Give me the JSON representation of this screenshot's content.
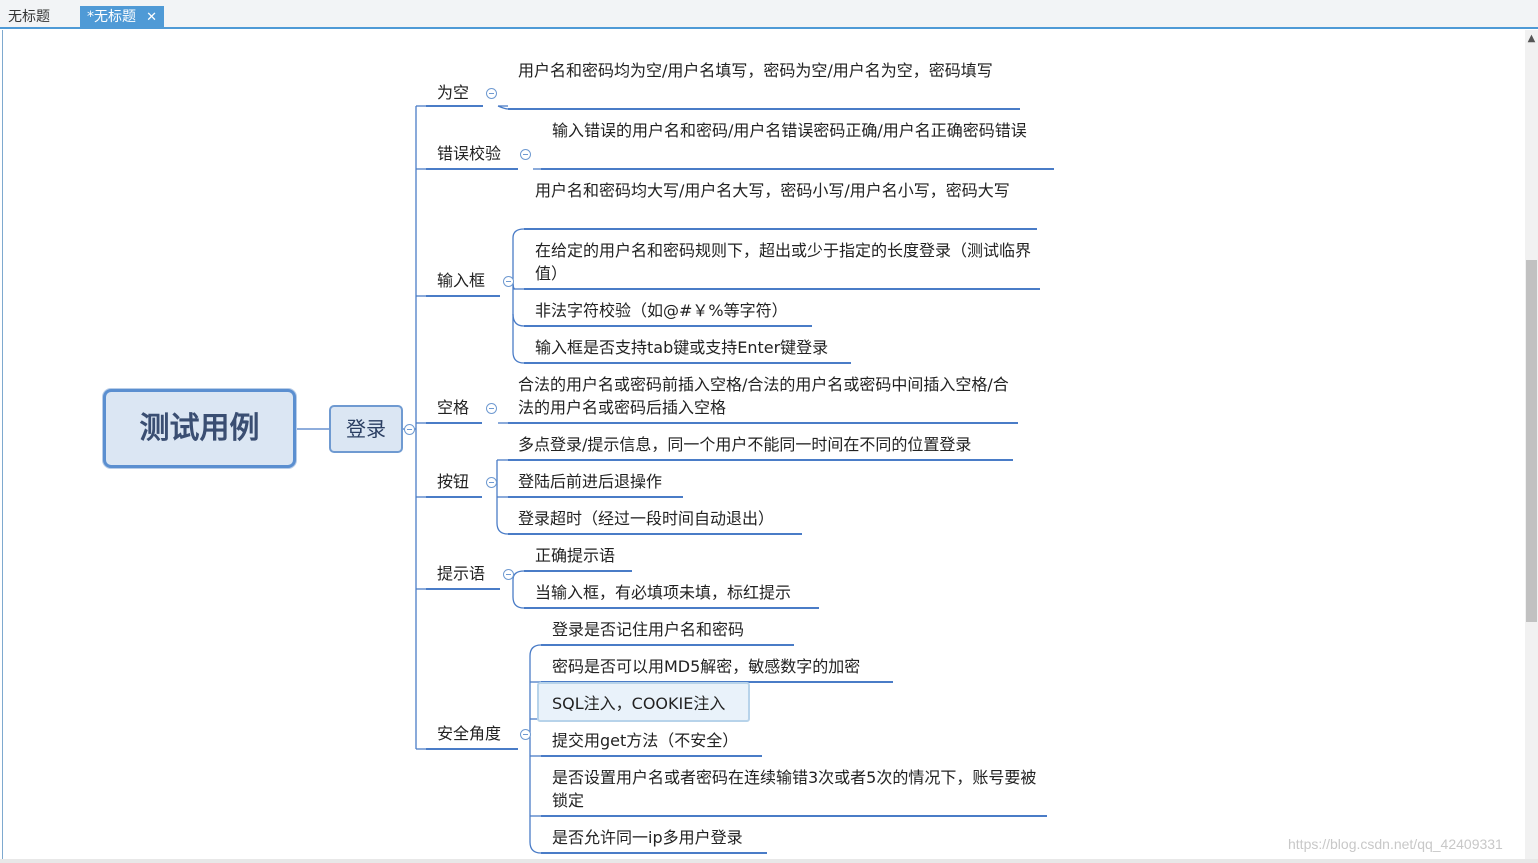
{
  "tabs": [
    {
      "label": "无标题"
    },
    {
      "label": "*无标题",
      "close": "✕"
    }
  ],
  "map": {
    "root": "测试用例",
    "branch": "登录",
    "categories": [
      {
        "label": "为空",
        "items": [
          "用户名和密码均为空/用户名填写，密码为空/用户名为空，密码填写"
        ]
      },
      {
        "label": "错误校验",
        "items": [
          "输入错误的用户名和密码/用户名错误密码正确/用户名正确密码错误"
        ]
      },
      {
        "label": "输入框",
        "items": [
          "用户名和密码均大写/用户名大写，密码小写/用户名小写，密码大写",
          "在给定的用户名和密码规则下，超出或少于指定的长度登录（测试临界值）",
          "非法字符校验（如@#￥%等字符）",
          "输入框是否支持tab键或支持Enter键登录"
        ]
      },
      {
        "label": "空格",
        "items": [
          " 合法的用户名或密码前插入空格/合法的用户名或密码中间插入空格/合法的用户名或密码后插入空格"
        ]
      },
      {
        "label": "按钮",
        "items": [
          "多点登录/提示信息，同一个用户不能同一时间在不同的位置登录",
          "登陆后前进后退操作",
          "登录超时（经过一段时间自动退出）"
        ]
      },
      {
        "label": "提示语",
        "items": [
          "正确提示语",
          "当输入框，有必填项未填，标红提示"
        ]
      },
      {
        "label": "安全角度",
        "items": [
          "登录是否记住用户名和密码",
          "密码是否可以用MD5解密，敏感数字的加密",
          "SQL注入，COOKIE注入",
          "提交用get方法（不安全）",
          " 是否设置用户名或者密码在连续输错3次或者5次的情况下，账号要被锁定",
          "是否允许同一ip多用户登录"
        ]
      }
    ]
  },
  "scrollbar": {
    "up_arrow": "▲"
  },
  "watermark": "https://blog.csdn.net/qq_42409331",
  "colors": {
    "accent": "#4f9ad6",
    "line": "#4a7cc7",
    "root_fill": "#dbe6f3"
  }
}
